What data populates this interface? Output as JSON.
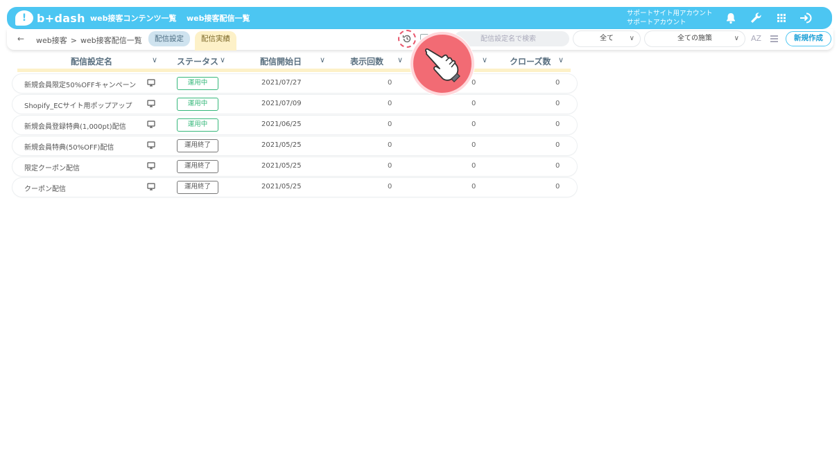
{
  "app": {
    "logo_text": "b+dash",
    "logo_mark": "!"
  },
  "nav": {
    "contents": "web接客コンテンツ一覧",
    "deliveries": "web接客配信一覧"
  },
  "account": {
    "line1": "サポートサイト用アカウント",
    "line2": "サポートアカウント"
  },
  "icons": {
    "notifications": "bell-icon",
    "tools": "wrench-icon",
    "apps": "grid-icon",
    "logout": "logout-icon"
  },
  "breadcrumb": {
    "back": "←",
    "root": "web接客",
    "sep": ">",
    "current": "web接客配信一覧"
  },
  "tabs": {
    "settings": "配信設定",
    "results": "配信実績"
  },
  "search": {
    "placeholder": "配信設定名で検索"
  },
  "filters": {
    "status_selected": "全て",
    "measure_selected": "全ての施策"
  },
  "toolbar": {
    "sort_label": "AZ",
    "new_label": "新規作成"
  },
  "table": {
    "columns": {
      "name": "配信設定名",
      "status": "ステータス",
      "start_date": "配信開始日",
      "impressions": "表示回数",
      "closes": "クローズ数"
    },
    "rows": [
      {
        "name": "新規会員限定50%OFFキャンペーン",
        "status": "運用中",
        "active": true,
        "date": "2021/07/27",
        "impressions": "0",
        "clicks": "0",
        "closes": "0"
      },
      {
        "name": "Shopify_ECサイト用ポップアップ",
        "status": "運用中",
        "active": true,
        "date": "2021/07/09",
        "impressions": "0",
        "clicks": "0",
        "closes": "0"
      },
      {
        "name": "新規会員登録特典(1,000pt)配信",
        "status": "運用中",
        "active": true,
        "date": "2021/06/25",
        "impressions": "0",
        "clicks": "0",
        "closes": "0"
      },
      {
        "name": "新規会員特典(50%OFF)配信",
        "status": "運用終了",
        "active": false,
        "date": "2021/05/25",
        "impressions": "0",
        "clicks": "0",
        "closes": "0"
      },
      {
        "name": "限定クーポン配信",
        "status": "運用終了",
        "active": false,
        "date": "2021/05/25",
        "impressions": "0",
        "clicks": "0",
        "closes": "0"
      },
      {
        "name": "クーポン配信",
        "status": "運用終了",
        "active": false,
        "date": "2021/05/25",
        "impressions": "0",
        "clicks": "0",
        "closes": "0"
      }
    ]
  },
  "colors": {
    "brand": "#4cc6f2",
    "active": "#35b77a",
    "ended": "#777777",
    "highlight": "#f26b74",
    "tab_results": "#fdf1c8"
  }
}
